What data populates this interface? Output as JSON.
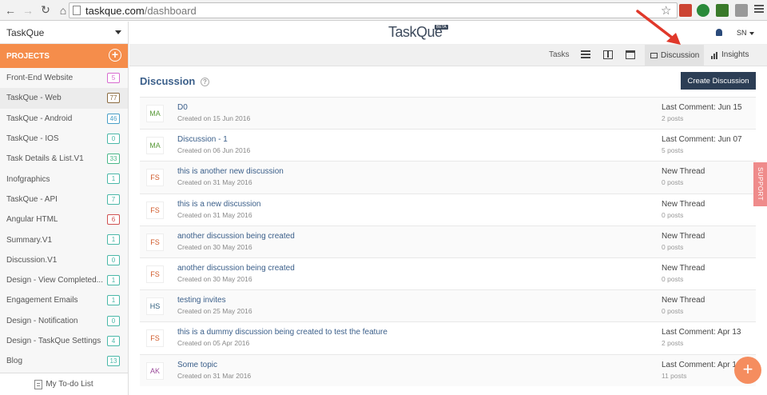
{
  "browser": {
    "url_host": "taskque.com",
    "url_path": "/dashboard"
  },
  "sidebar": {
    "workspace": "TaskQue",
    "projects_label": "PROJECTS",
    "add_label": "+",
    "projects": [
      {
        "name": "Front-End Website",
        "count": "5",
        "color": "#d86bd0"
      },
      {
        "name": "TaskQue - Web",
        "count": "77",
        "color": "#8a6a3e"
      },
      {
        "name": "TaskQue - Android",
        "count": "46",
        "color": "#4aa0c8"
      },
      {
        "name": "TaskQue - IOS",
        "count": "0",
        "color": "#4ab8a8"
      },
      {
        "name": "Task Details & List.V1",
        "count": "33",
        "color": "#4ab88a"
      },
      {
        "name": "Inofgraphics",
        "count": "1",
        "color": "#4ab8a8"
      },
      {
        "name": "TaskQue - API",
        "count": "7",
        "color": "#4ab8a8"
      },
      {
        "name": "Angular HTML",
        "count": "6",
        "color": "#d05050"
      },
      {
        "name": "Summary.V1",
        "count": "1",
        "color": "#4ab8a8"
      },
      {
        "name": "Discussion.V1",
        "count": "0",
        "color": "#4ab8a8"
      },
      {
        "name": "Design - View Completed...",
        "count": "1",
        "color": "#4ab8a8"
      },
      {
        "name": "Engagement Emails",
        "count": "1",
        "color": "#4ab8a8"
      },
      {
        "name": "Design - Notification",
        "count": "0",
        "color": "#4ab8a8"
      },
      {
        "name": "Design - TaskQue Settings",
        "count": "4",
        "color": "#4ab8a8"
      },
      {
        "name": "Blog",
        "count": "13",
        "color": "#4ab8a8"
      }
    ],
    "todo_label": "My To-do List"
  },
  "header": {
    "logo": "TaskQue",
    "beta": "BETA",
    "user": "SN"
  },
  "toolbar": {
    "tasks": "Tasks",
    "discussion": "Discussion",
    "insights": "Insights"
  },
  "main": {
    "title": "Discussion",
    "help": "?",
    "create_label": "Create Discussion",
    "discussions": [
      {
        "initials": "MA",
        "title": "D0",
        "created": "Created on 15 Jun 2016",
        "last": "Last Comment: Jun 15",
        "posts": "2 posts",
        "color": "#5a9a3a"
      },
      {
        "initials": "MA",
        "title": "Discussion - 1",
        "created": "Created on 06 Jun 2016",
        "last": "Last Comment: Jun 07",
        "posts": "5 posts",
        "color": "#5a9a3a"
      },
      {
        "initials": "FS",
        "title": "this is another new discussion",
        "created": "Created on 31 May 2016",
        "last": "New Thread",
        "posts": "0 posts",
        "color": "#d05a2a"
      },
      {
        "initials": "FS",
        "title": "this is a new discussion",
        "created": "Created on 31 May 2016",
        "last": "New Thread",
        "posts": "0 posts",
        "color": "#d05a2a"
      },
      {
        "initials": "FS",
        "title": "another discussion being created",
        "created": "Created on 30 May 2016",
        "last": "New Thread",
        "posts": "0 posts",
        "color": "#d05a2a"
      },
      {
        "initials": "FS",
        "title": "another discussion being created",
        "created": "Created on 30 May 2016",
        "last": "New Thread",
        "posts": "0 posts",
        "color": "#d05a2a"
      },
      {
        "initials": "HS",
        "title": "testing invites",
        "created": "Created on 25 May 2016",
        "last": "New Thread",
        "posts": "0 posts",
        "color": "#2a5a7a"
      },
      {
        "initials": "FS",
        "title": "this is a dummy discussion being created to test the feature",
        "created": "Created on 05 Apr 2016",
        "last": "Last Comment: Apr 13",
        "posts": "2 posts",
        "color": "#d05a2a"
      },
      {
        "initials": "AK",
        "title": "Some topic",
        "created": "Created on 31 Mar 2016",
        "last": "Last Comment: Apr 13",
        "posts": "11 posts",
        "color": "#9a4a9a"
      }
    ]
  },
  "support_label": "SUPPORT",
  "fab_label": "+"
}
